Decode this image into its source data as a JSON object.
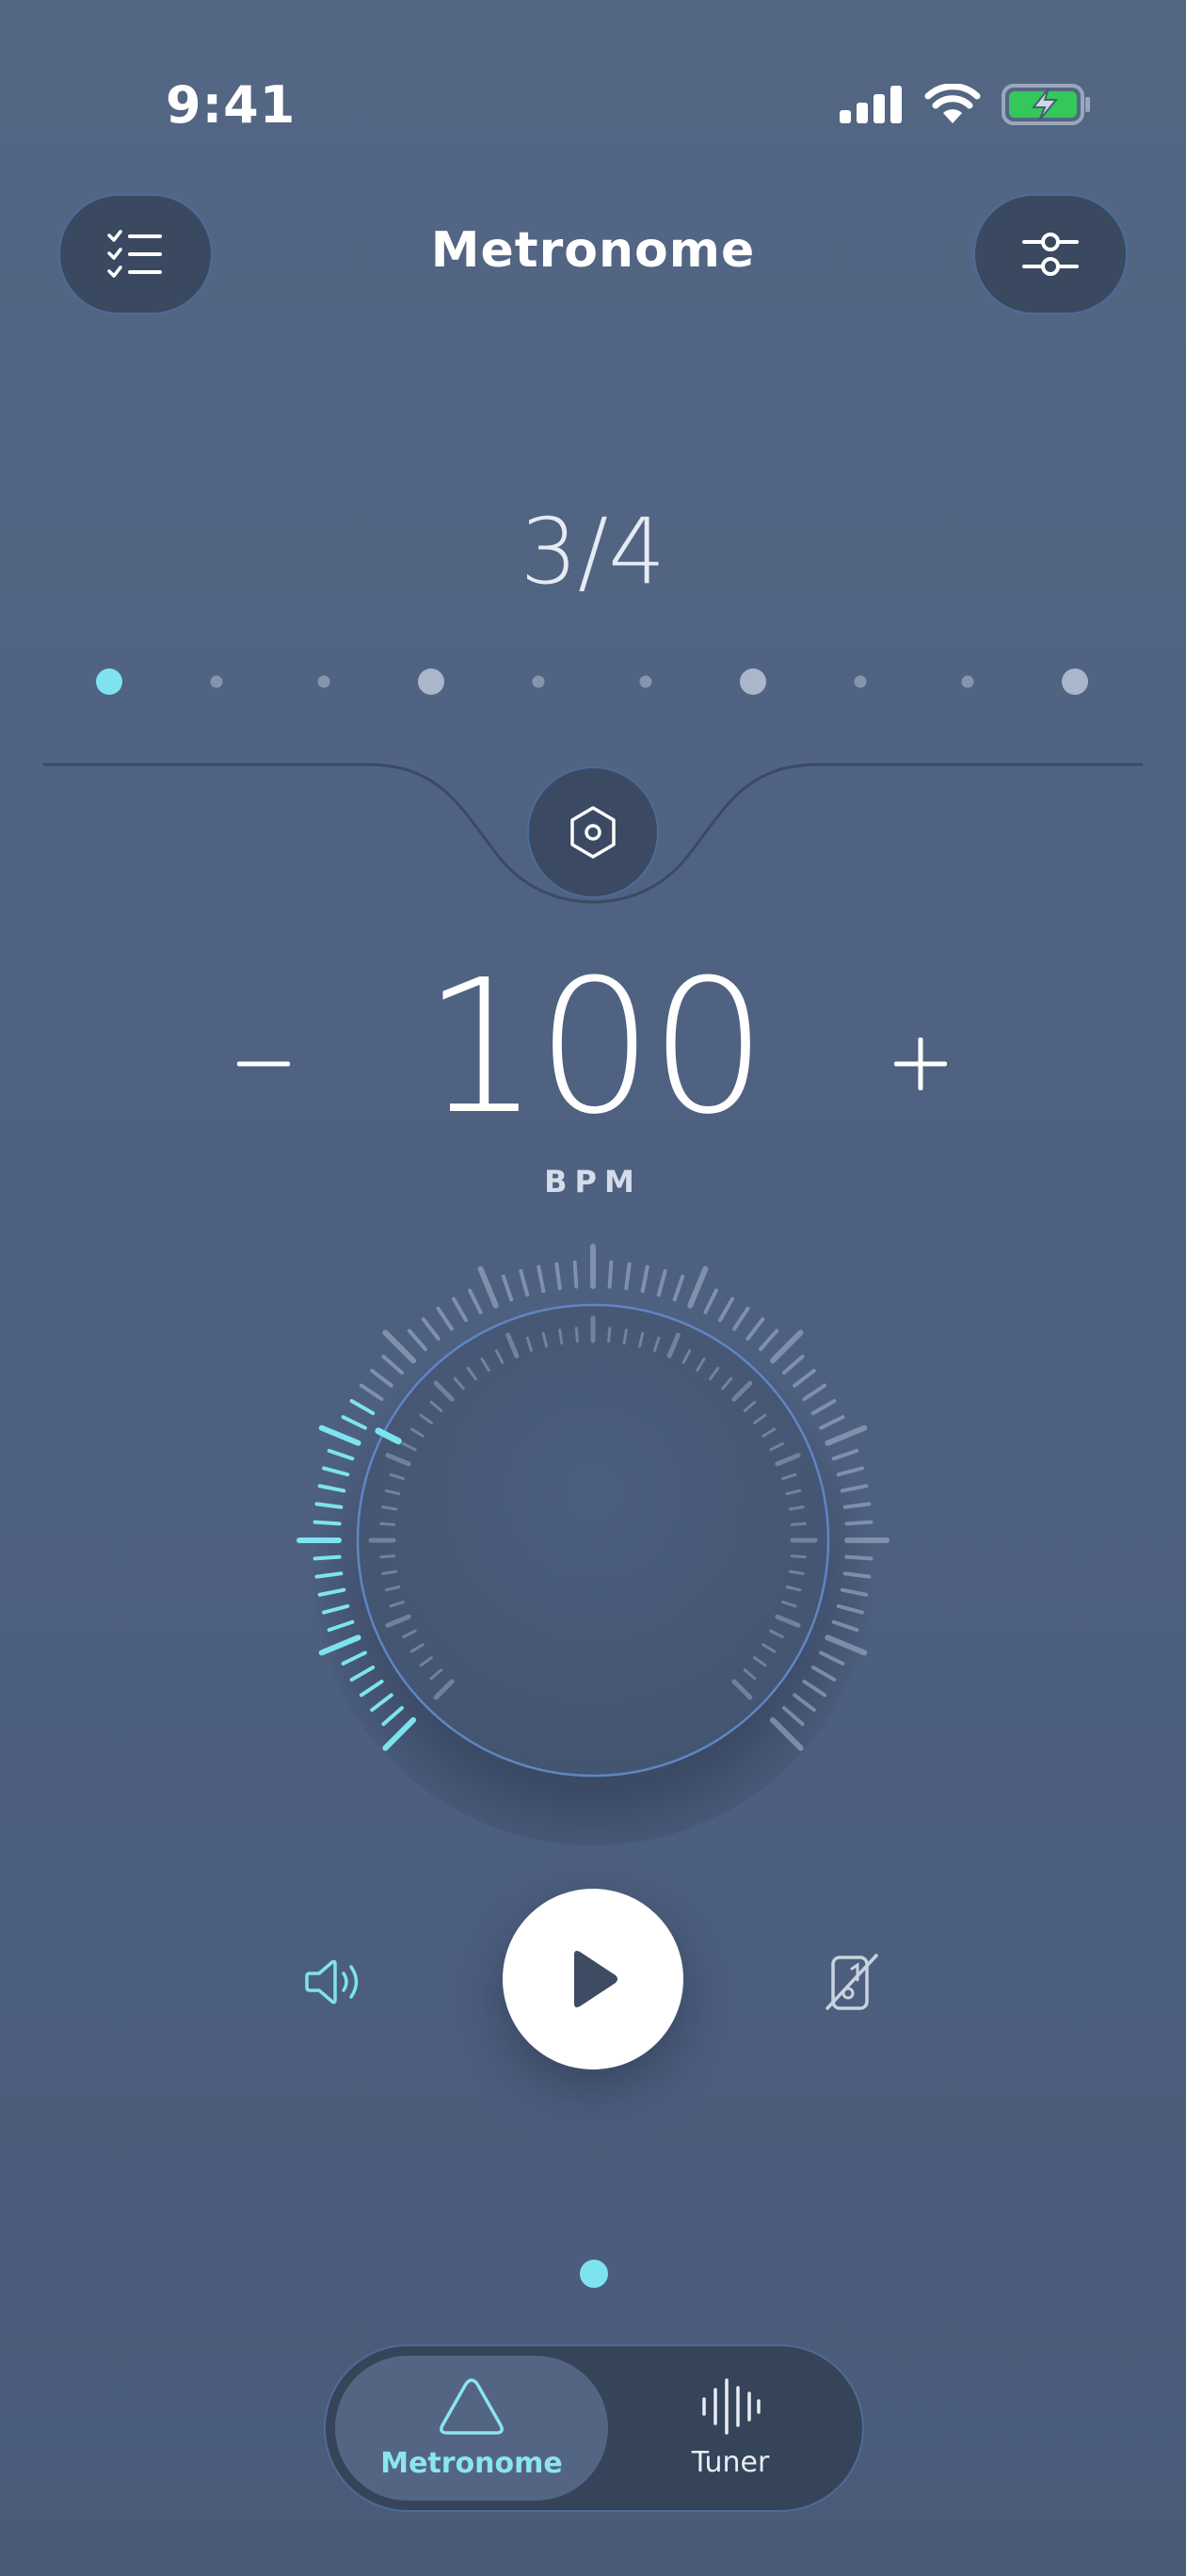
{
  "status_bar": {
    "time": "9:41"
  },
  "header": {
    "title": "Metronome",
    "left_button_icon": "checklist-icon",
    "right_button_icon": "sliders-icon"
  },
  "time_signature": {
    "label": "3/4",
    "active_beat_index": 0
  },
  "tempo": {
    "value": "100",
    "unit": "BPM",
    "minus_label": "−",
    "plus_label": "+"
  },
  "controls": {
    "sound_icon": "speaker-icon",
    "play_icon": "play-icon",
    "vibration_icon": "vibration-off-icon"
  },
  "pager": {
    "active_page": 1,
    "total_pages": 1
  },
  "tabs": [
    {
      "label": "Metronome",
      "icon": "triangle-metronome-icon",
      "active": true
    },
    {
      "label": "Tuner",
      "icon": "waveform-icon",
      "active": false
    }
  ],
  "colors": {
    "accent": "#7ee3ee",
    "background": "#536684",
    "control_surface": "#3a4960",
    "border": "#4d6b98"
  }
}
